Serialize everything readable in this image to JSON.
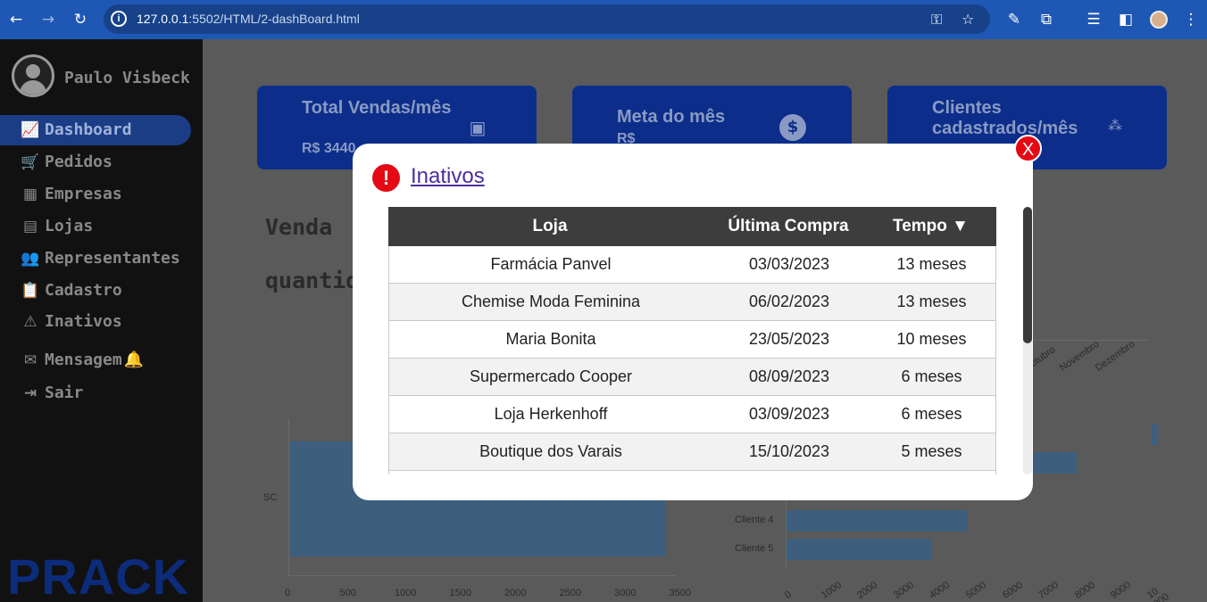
{
  "browser": {
    "url_host": "127.0.0.1",
    "url_rest": ":5502/HTML/2-dashBoard.html"
  },
  "sidebar": {
    "user_name": "Paulo Visbeck",
    "items": [
      {
        "label": "Dashboard",
        "icon": "chart-icon",
        "glyph": "📈"
      },
      {
        "label": "Pedidos",
        "icon": "cart-icon",
        "glyph": "🛒"
      },
      {
        "label": "Empresas",
        "icon": "building-icon",
        "glyph": "▦"
      },
      {
        "label": "Lojas",
        "icon": "store-icon",
        "glyph": "▤"
      },
      {
        "label": "Representantes",
        "icon": "users-icon",
        "glyph": "👥"
      },
      {
        "label": "Cadastro",
        "icon": "clipboard-icon",
        "glyph": "📋"
      },
      {
        "label": "Inativos",
        "icon": "warning-icon",
        "glyph": "⚠"
      },
      {
        "label": "Mensagem",
        "icon": "envelope-icon",
        "glyph": "✉"
      },
      {
        "label": "Sair",
        "icon": "logout-icon",
        "glyph": "⇥"
      }
    ],
    "bell_glyph": "🔔",
    "brand": "PRACK"
  },
  "cards": [
    {
      "title": "Total Vendas/mês",
      "value": "R$ 3440",
      "icon": "money-icon"
    },
    {
      "title": "Meta do mês",
      "value": "R$",
      "icon": "dollar-icon"
    },
    {
      "title": "Clientes cadastrados/mês",
      "value": "",
      "icon": "users-icon"
    }
  ],
  "sections": {
    "venda": "Venda",
    "quantidade": "quantid"
  },
  "left_chart": {
    "category": "SC",
    "x_ticks": [
      "0",
      "500",
      "1000",
      "1500",
      "2000",
      "2500",
      "3000",
      "3500"
    ]
  },
  "right_top_chart": {
    "x_ticks": [
      "bro",
      "Outubro",
      "Novembro",
      "Dezembro"
    ]
  },
  "right_bar_chart": {
    "categories": [
      "Cliente 4",
      "Cliente 5"
    ],
    "x_ticks": [
      "0",
      "1000",
      "2000",
      "3000",
      "4000",
      "5000",
      "6000",
      "7000",
      "8000",
      "9000",
      "10 000"
    ]
  },
  "modal": {
    "close_label": "X",
    "alert_glyph": "!",
    "title": "Inativos",
    "columns": [
      "Loja",
      "Última Compra",
      "Tempo ▼"
    ],
    "rows": [
      {
        "loja": "Farmácia Panvel",
        "ultima": "03/03/2023",
        "tempo": "13 meses"
      },
      {
        "loja": "Chemise Moda Feminina",
        "ultima": "06/02/2023",
        "tempo": "13 meses"
      },
      {
        "loja": "Maria Bonita",
        "ultima": "23/05/2023",
        "tempo": "10 meses"
      },
      {
        "loja": "Supermercado Cooper",
        "ultima": "08/09/2023",
        "tempo": "6 meses"
      },
      {
        "loja": "Loja Herkenhoff",
        "ultima": "03/09/2023",
        "tempo": "6 meses"
      },
      {
        "loja": "Boutique dos Varais",
        "ultima": "15/10/2023",
        "tempo": "5 meses"
      }
    ]
  }
}
